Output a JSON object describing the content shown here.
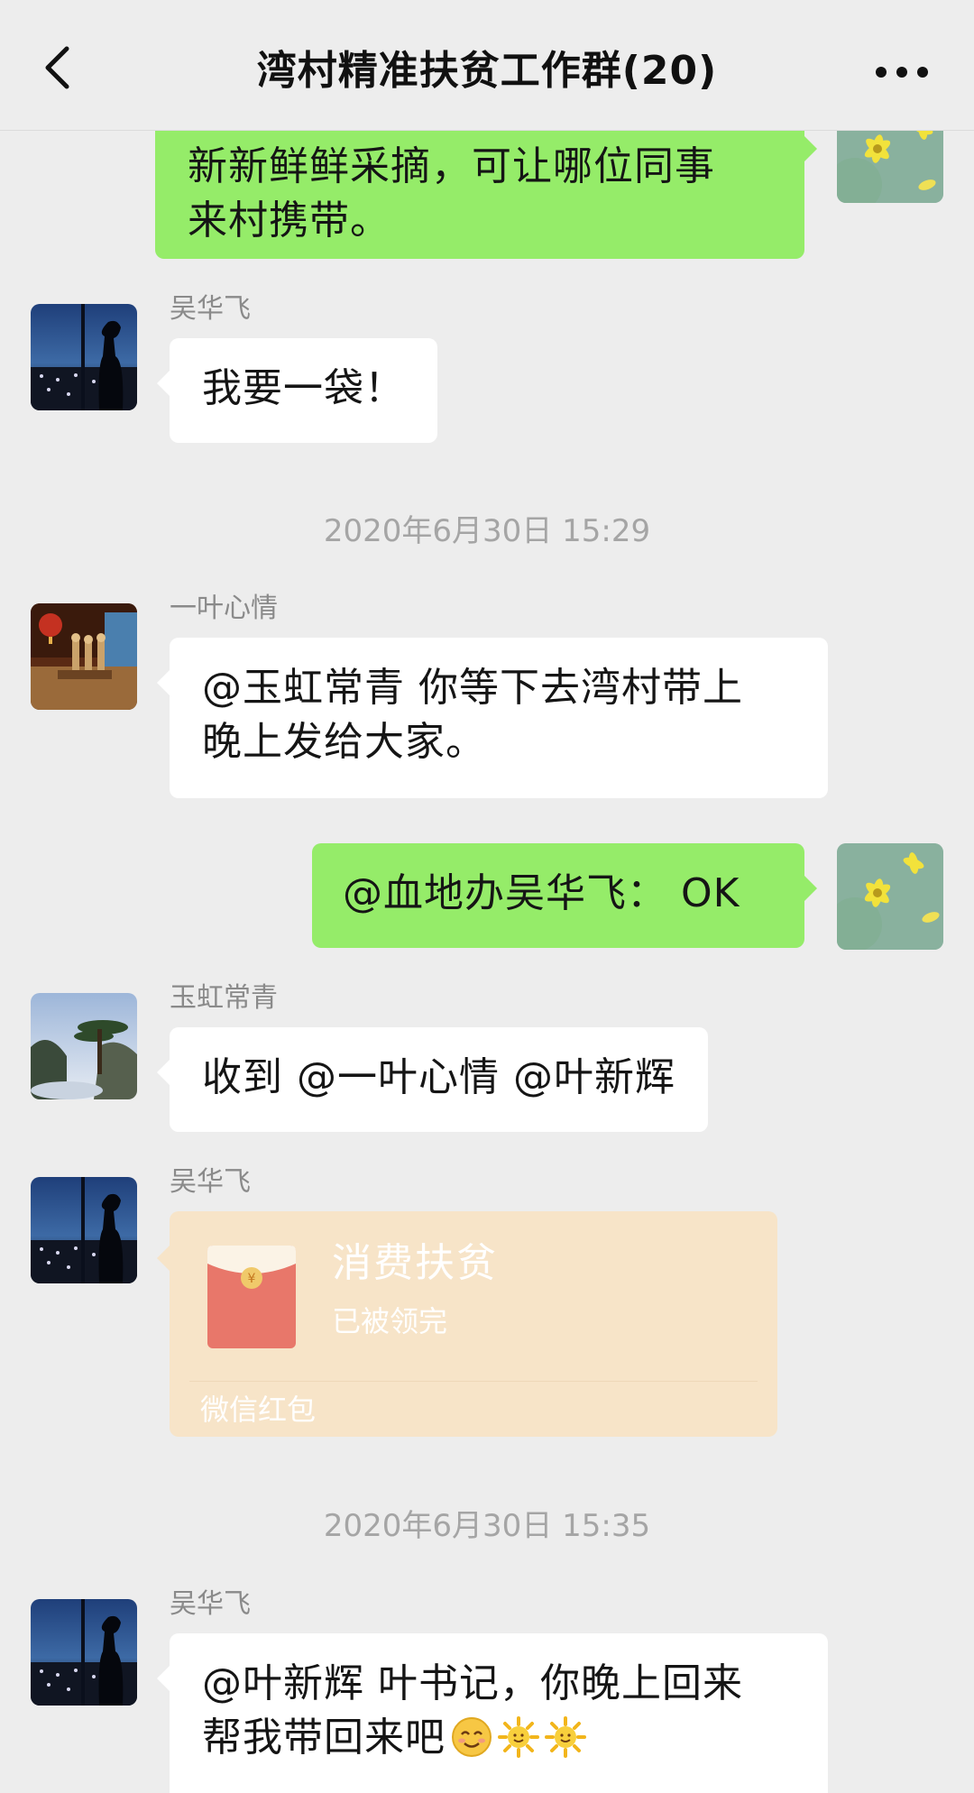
{
  "header": {
    "title": "湾村精准扶贫工作群(20)",
    "back_icon": "chevron-left-icon",
    "more_icon": "more-dots-icon"
  },
  "messages": [
    {
      "type": "text",
      "direction": "out",
      "text": "新新鲜鲜采摘，可让哪位同事\n来村携带。"
    },
    {
      "type": "text",
      "direction": "in",
      "sender": "吴华飞",
      "text": "我要一袋！"
    },
    {
      "type": "time",
      "text": "2020年6月30日 15:29"
    },
    {
      "type": "text",
      "direction": "in",
      "sender": "一叶心情",
      "text": "@玉虹常青 你等下去湾村带上\n晚上发给大家。"
    },
    {
      "type": "text",
      "direction": "out",
      "text": "@血地办吴华飞： OK"
    },
    {
      "type": "text",
      "direction": "in",
      "sender": "玉虹常青",
      "text": "收到 @一叶心情 @叶新辉"
    },
    {
      "type": "redpacket",
      "direction": "in",
      "sender": "吴华飞",
      "title": "消费扶贫",
      "status": "已被领完",
      "footer": "微信红包"
    },
    {
      "type": "time",
      "text": "2020年6月30日 15:35"
    },
    {
      "type": "text",
      "direction": "in",
      "sender": "吴华飞",
      "text_line1": "@叶新辉 叶书记，你晚上回来",
      "text_line2": "帮我带回来吧",
      "emojis": [
        "smile-emoji",
        "sun-emoji",
        "sun-emoji"
      ]
    }
  ],
  "colors": {
    "background": "#ededed",
    "outgoing_bubble": "#95ec69",
    "incoming_bubble": "#ffffff",
    "redpacket_opened": "#f7e4c8",
    "redpacket_icon": "#e8776a"
  }
}
